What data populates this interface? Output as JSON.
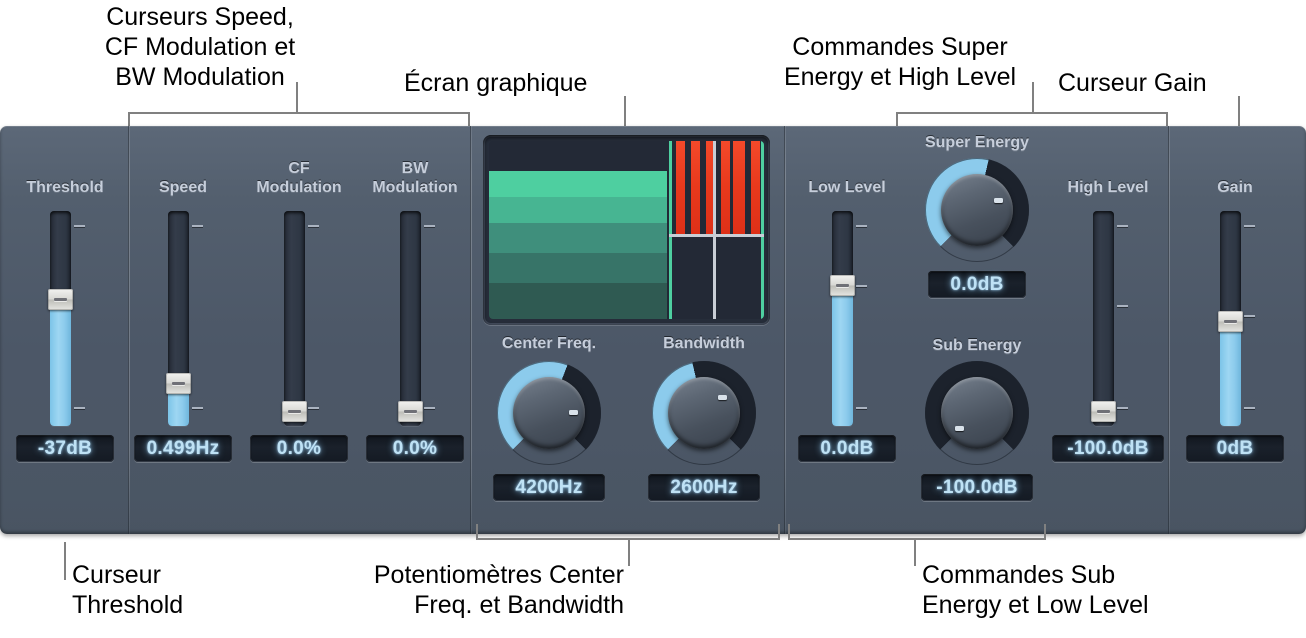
{
  "annotations": {
    "top_left": {
      "text": "Curseurs Speed,\nCF Modulation et\nBW Modulation"
    },
    "top_mid": {
      "text": "Écran graphique"
    },
    "top_right": {
      "text": "Commandes Super\nEnergy et High Level"
    },
    "top_far_right": {
      "text": "Curseur Gain"
    },
    "bottom_left": {
      "text": "Curseur\nThreshold"
    },
    "bottom_mid": {
      "text": "Potentiomètres Center\nFreq. et Bandwidth"
    },
    "bottom_right": {
      "text": "Commandes Sub\nEnergy et Low Level"
    }
  },
  "panel": {
    "controls": {
      "threshold": {
        "label": "Threshold",
        "value": "-37dB",
        "unit": "dB",
        "position_pct": 41
      },
      "speed": {
        "label": "Speed",
        "value": "0.499Hz",
        "unit": "Hz",
        "position_pct": 80
      },
      "cf_modulation": {
        "label": "CF\nModulation",
        "value": "0.0%",
        "unit": "%",
        "position_pct": 98
      },
      "bw_modulation": {
        "label": "BW\nModulation",
        "value": "0.0%",
        "unit": "%",
        "position_pct": 98
      },
      "center_freq": {
        "label": "Center Freq.",
        "value": "4200Hz",
        "unit": "Hz",
        "angle_deg": 108
      },
      "bandwidth": {
        "label": "Bandwidth",
        "value": "2600Hz",
        "unit": "Hz",
        "angle_deg": 62
      },
      "low_level": {
        "label": "Low Level",
        "value": "0.0dB",
        "unit": "dB",
        "position_pct": 33
      },
      "super_energy": {
        "label": "Super Energy",
        "value": "0.0dB",
        "unit": "dB",
        "angle_deg": 75
      },
      "sub_energy": {
        "label": "Sub Energy",
        "value": "-100.0dB",
        "unit": "dB",
        "angle_deg": -125
      },
      "high_level": {
        "label": "High Level",
        "value": "-100.0dB",
        "unit": "dB",
        "position_pct": 100
      },
      "gain": {
        "label": "Gain",
        "value": "0dB",
        "unit": "dB",
        "position_pct": 50
      }
    },
    "display": {
      "name": "graphic-display",
      "green_bands": [
        "#4ecfa0",
        "#47b592",
        "#3f8f7c",
        "#377468",
        "#2f5a52"
      ],
      "red_bar_count": 7,
      "red_bar_color": "#e8391c",
      "marker_line_color": "#4ecfa0",
      "center_line_color": "#c9ced6"
    }
  },
  "colors": {
    "panel_bg": "#4f5a69",
    "slider_fill": "#8ccbec",
    "knob_arc": "#8ccbec",
    "readout_text": "#bfe2f5",
    "label_text": "#c6cedb",
    "callout_text": "#000000",
    "leader_line": "#808080"
  }
}
